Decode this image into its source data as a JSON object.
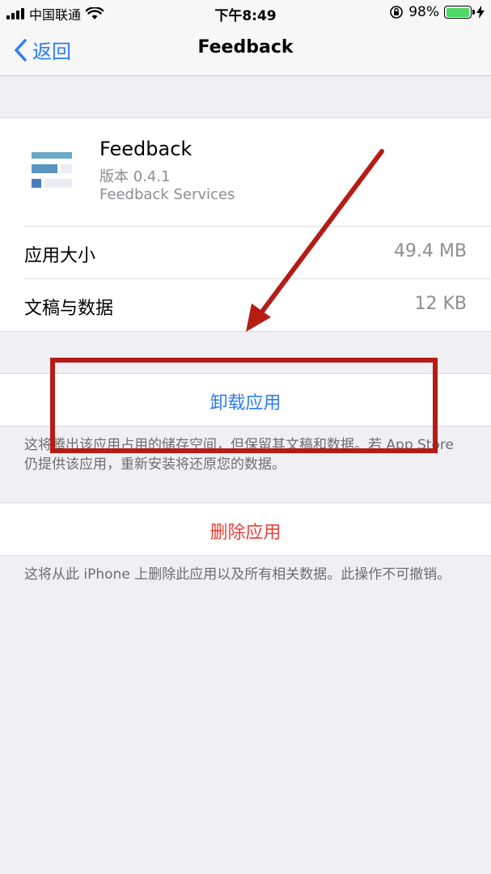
{
  "status_bar": {
    "carrier": "中国联通",
    "time": "下午8:49",
    "battery_percent": "98%",
    "battery_level": 0.98
  },
  "nav": {
    "back_label": "返回",
    "title": "Feedback"
  },
  "app": {
    "name": "Feedback",
    "version": "版本 0.4.1",
    "vendor": "Feedback Services",
    "rows": [
      {
        "label": "应用大小",
        "value": "49.4 MB"
      },
      {
        "label": "文稿与数据",
        "value": "12 KB"
      }
    ]
  },
  "offload": {
    "button_label": "卸载应用",
    "note": "这将腾出该应用占用的储存空间，但保留其文稿和数据。若 App Store 仍提供该应用，重新安装将还原您的数据。"
  },
  "delete": {
    "button_label": "删除应用",
    "note": "这将从此 iPhone 上删除此应用以及所有相关数据。此操作不可撤销。"
  },
  "colors": {
    "accent": "#2f7cf6",
    "destructive": "#e8413a",
    "annotation": "#b51c16",
    "battery": "#4cd964"
  }
}
